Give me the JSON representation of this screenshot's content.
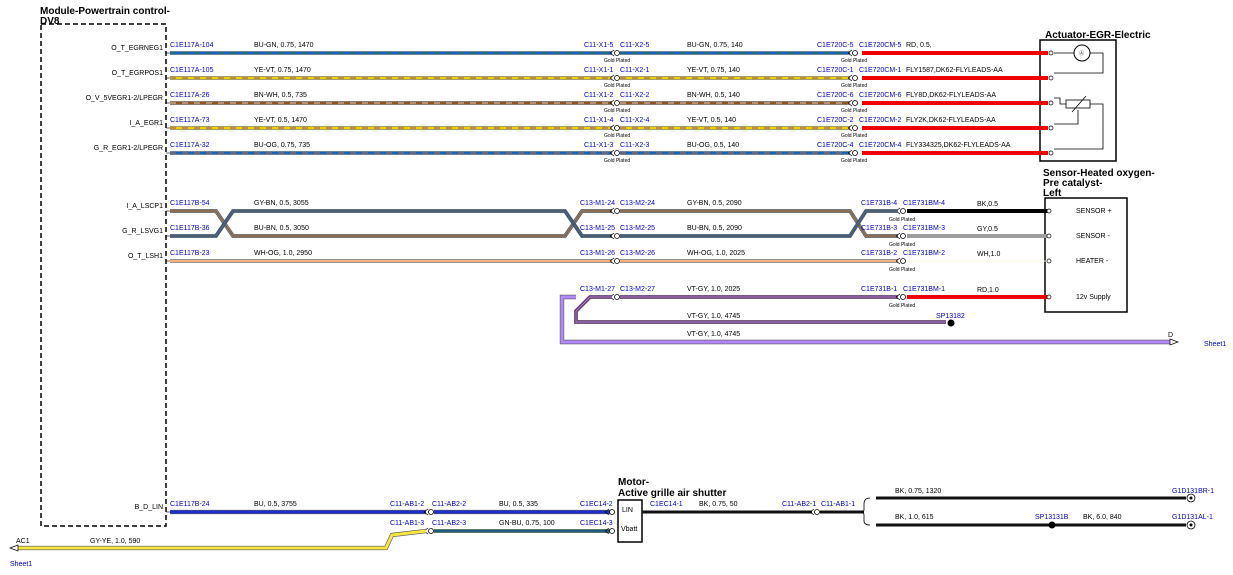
{
  "module_title": [
    "Module-Powertrain control-",
    "DV8"
  ],
  "actuator_title": "Actuator-EGR-Electric",
  "sensor_title": [
    "Sensor-Heated oxygen-",
    "Pre catalyst-",
    "Left"
  ],
  "motor_title": [
    "Motor-",
    "Active grille air shutter"
  ],
  "gold_plated": "Gold Plated",
  "egr_wires": [
    {
      "pin": "O_T_EGRNEG1",
      "c1": "C1E117A-104",
      "spec1": "BU-GN, 0.75, 1470",
      "x1": "C11-X1-5",
      "x2": "C11-X2-5",
      "spec2": "BU-GN, 0.75, 140",
      "e1": "C1E720C-5",
      "e2": "C1E720CM-5",
      "end": "RD, 0.5,",
      "color": "#1565c0",
      "color2": "#2e7d32"
    },
    {
      "pin": "O_T_EGRPOS1",
      "c1": "C1E117A-105",
      "spec1": "YE-VT, 0.75, 1470",
      "x1": "C11-X1-1",
      "x2": "C11-X2-1",
      "spec2": "YE-VT, 0.75, 140",
      "e1": "C1E720C-1",
      "e2": "C1E720CM-1",
      "end": "FLY1587,DK62-FLYLEADS-AA",
      "color": "#e6d200",
      "color2": "#7b1fa2"
    },
    {
      "pin": "O_V_5VEGR1-2/LPEGR",
      "c1": "C1E117A-26",
      "spec1": "BN-WH, 0.5, 735",
      "x1": "C11-X1-2",
      "x2": "C11-X2-2",
      "spec2": "BN-WH, 0.5, 140",
      "e1": "C1E720C-6",
      "e2": "C1E720CM-6",
      "end": "FLY8D,DK62-FLYLEADS-AA",
      "color": "#8d5524",
      "color2": "#f5f5f5"
    },
    {
      "pin": "I_A_EGR1",
      "c1": "C1E117A-73",
      "spec1": "YE-VT, 0.5, 1470",
      "x1": "C11-X1-4",
      "x2": "C11-X2-4",
      "spec2": "YE-VT, 0.5, 140",
      "e1": "C1E720C-2",
      "e2": "C1E720CM-2",
      "end": "FLY2K,DK62-FLYLEADS-AA",
      "color": "#e6d200",
      "color2": "#7b1fa2"
    },
    {
      "pin": "G_R_EGR1-2/LPEGR",
      "c1": "C1E117A-32",
      "spec1": "BU-OG, 0.75, 735",
      "x1": "C11-X1-3",
      "x2": "C11-X2-3",
      "spec2": "BU-OG, 0.5, 140",
      "e1": "C1E720C-4",
      "e2": "C1E720CM-4",
      "end": "FLY334325,DK62-FLYLEADS-AA",
      "color": "#1565c0",
      "color2": "#ef6c00"
    }
  ],
  "o2_wires": [
    {
      "pin": "I_A_LSCP1",
      "c1": "C1E117B-54",
      "spec1": "GY-BN, 0.5, 3055",
      "m1": "C13-M1-24",
      "m2": "C13-M2-24",
      "spec2": "GY-BN, 0.5, 2090",
      "s1": "C1E731B-4",
      "s2": "C1E731BM-4",
      "end": "BK,0.5",
      "func": "SENSOR +"
    },
    {
      "pin": "G_R_LSVG1",
      "c1": "C1E117B-36",
      "spec1": "BU-BN, 0.5, 3050",
      "m1": "C13-M1-25",
      "m2": "C13-M2-25",
      "spec2": "BU-BN, 0.5, 2090",
      "s1": "C1E731B-3",
      "s2": "C1E731BM-3",
      "end": "GY,0.5",
      "func": "SENSOR -"
    },
    {
      "pin": "O_T_LSH1",
      "c1": "C1E117B-23",
      "spec1": "WH-OG, 1.0, 2950",
      "m1": "C13-M1-26",
      "m2": "C13-M2-26",
      "spec2": "WH-OG, 1.0, 2025",
      "s1": "C1E731B-2",
      "s2": "C1E731BM-2",
      "end": "WH,1.0",
      "func": "HEATER -"
    },
    {
      "pin": "",
      "c1": "",
      "spec1": "",
      "m1": "C13-M1-27",
      "m2": "C13-M2-27",
      "spec2": "VT-GY, 1.0, 2025",
      "s1": "C1E731B-1",
      "s2": "C1E731BM-1",
      "end": "RD,1.0",
      "func": "12v Supply"
    }
  ],
  "splice_a": {
    "spec": "VT-GY, 1.0, 4745",
    "label": "SP13182"
  },
  "splice_b": {
    "spec": "VT-GY, 1.0, 4745",
    "letter": "D",
    "sheet": "Sheet1"
  },
  "lin_wire": {
    "pin": "B_D_LIN",
    "c1": "C1E117B-24",
    "a1": "C11-AB1-2",
    "a2": "C11-AB2-2",
    "spec1": "BU, 0.5, 3755",
    "spec2": "BU, 0.5, 335",
    "m": "C1EC14-2",
    "label": "LIN"
  },
  "vbatt_wire": {
    "a1": "C11-AB1-3",
    "a2": "C11-AB2-3",
    "spec": "GN-BU, 0.75, 100",
    "m": "C1EC14-3",
    "label": "Vbatt"
  },
  "ac1": {
    "letter": "AC1",
    "spec": "GY-YE, 1.0, 590",
    "sheet": "Sheet1"
  },
  "ground": {
    "m": "C1EC14-1",
    "spec": "BK, 0.75, 50",
    "b1": "C11-AB2-1",
    "b2": "C11-AB1-1",
    "top_spec": "BK, 0.75, 1320",
    "top_end": "G1D131BR-1",
    "bot_spec": "BK, 1.0, 615",
    "splice": "SP13131B",
    "bot_spec2": "BK, 6.0, 840",
    "bot_end": "G1D131AL-1"
  }
}
